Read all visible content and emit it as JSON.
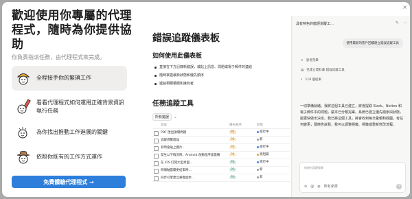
{
  "left": {
    "title": "歡迎使用你專屬的代理程式，隨時為你提供協助",
    "subtitle": "你負責指派任務，由代理程式來完成。",
    "features": [
      {
        "label": "全程接手你的繁瑣工作"
      },
      {
        "label": "看看代理程式如何運用正確背景資訊執行任務"
      },
      {
        "label": "為你找出推動工作進展的關鍵"
      },
      {
        "label": "依照你既有的工作方式運作"
      }
    ],
    "cta_label": "免費體驗代理程式 →"
  },
  "doc": {
    "title": "錯誤追蹤儀表板",
    "howto_heading": "如何使用此儀表板",
    "bullets": [
      "直接在下方記錄新錯誤，或貼上訊息、問題或電子郵件的連結",
      "隨時掌握最新狀態和優先順序",
      "遞給相關積極和擁有者"
    ],
    "tracker_heading": "任務追蹤工具",
    "view_chip": "所有錯誤",
    "columns": [
      "錯誤",
      "優先順序",
      "狀態"
    ],
    "rows": [
      {
        "name": "PDF 匯出損壞問題",
        "priority": "P1",
        "pclass": "p1",
        "status": "進行中",
        "scolor": "#3b82f6"
      },
      {
        "name": "追蹤導覽錯誤",
        "priority": "P2",
        "pclass": "p2",
        "status": "新",
        "scolor": "#9b9b9b"
      },
      {
        "name": "有時會貼上圖片…",
        "priority": "P2",
        "pclass": "p2",
        "status": "進行中",
        "scolor": "#3b82f6"
      },
      {
        "name": "發生以下情況時，Android 啟動程序會當機",
        "priority": "P2",
        "pclass": "p2",
        "status": "受阻礙",
        "scolor": "#e0a23a"
      },
      {
        "name": "在 iOS 打開大型頁面…",
        "priority": "P3",
        "pclass": "p3",
        "status": "進行中",
        "scolor": "#3b82f6"
      },
      {
        "name": "時間軸當變更結束時…",
        "priority": "P3",
        "pclass": "p3",
        "status": "新",
        "scolor": "#9b9b9b"
      },
      {
        "name": "同步引擎建立重複副本…",
        "priority": "P3",
        "pclass": "p3",
        "status": "新",
        "scolor": "#9b9b9b"
      }
    ]
  },
  "chat": {
    "title": "具有特色的錯誤追蹤工…",
    "user_message": "使用最新的客戶回饋建立錯誤追蹤工具",
    "step_think": "思考完畢",
    "step_search": "已建立資料庫 錯誤追蹤工具",
    "step_found": "118 個結果",
    "body": "一切準備就緒。我將這個工具已建立，將會提取 Slack、Notion 和電子郵件中的問題，嚴本已分類完畢。系統已建立優先順序與狀態，能更快做出決定。我已將這個工具，將會收到每日彙報和截圖，有任何變更，隨時告訴我，我可以調整標籤、標籤或重新修改流程。",
    "composer_context": "新增內容聽搜尋",
    "composer_source": "所有來源",
    "close_label": "×"
  }
}
